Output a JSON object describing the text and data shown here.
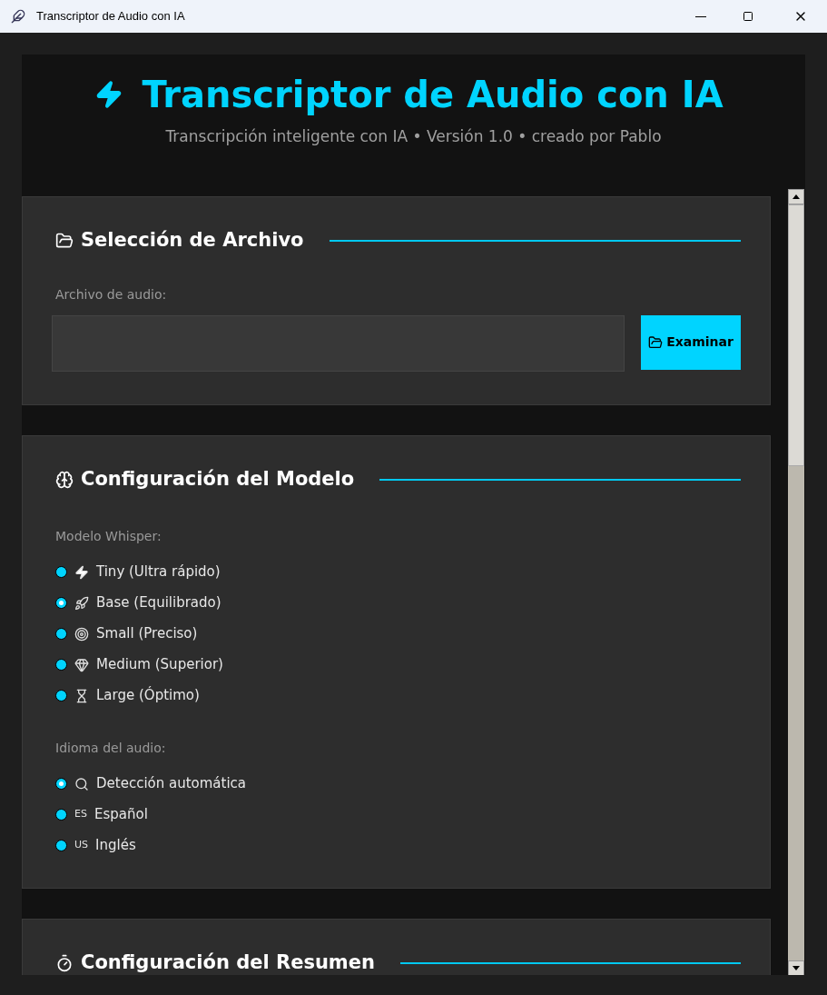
{
  "window": {
    "title": "Transcriptor de Audio con IA"
  },
  "header": {
    "title": "Transcriptor de Audio con IA",
    "subtitle": "Transcripción inteligente con IA • Versión 1.0 • creado por Pablo"
  },
  "file_section": {
    "title": "Selección de Archivo",
    "field_label": "Archivo de audio:",
    "browse_button": "Examinar"
  },
  "model_section": {
    "title": "Configuración del Modelo",
    "model_label": "Modelo Whisper:",
    "models": [
      {
        "kind": "bolt",
        "label": "Tiny (Ultra rápido)",
        "selected": false
      },
      {
        "kind": "rocket",
        "label": "Base (Equilibrado)",
        "selected": true
      },
      {
        "kind": "target",
        "label": "Small (Preciso)",
        "selected": false
      },
      {
        "kind": "gem",
        "label": "Medium (Superior)",
        "selected": false
      },
      {
        "kind": "hourglass",
        "label": "Large (Óptimo)",
        "selected": false
      }
    ],
    "language_label": "Idioma del audio:",
    "languages": [
      {
        "kind": "search",
        "label": "Detección automática",
        "selected": true
      },
      {
        "kind": "flag",
        "flag": "ES",
        "label": "Español",
        "selected": false
      },
      {
        "kind": "flag",
        "flag": "US",
        "label": "Inglés",
        "selected": false
      }
    ]
  },
  "summary_section": {
    "title": "Configuración del Resumen"
  }
}
